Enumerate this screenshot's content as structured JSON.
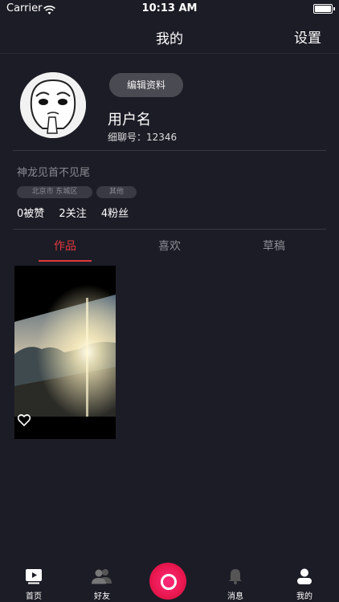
{
  "status_bar": {
    "carrier": "Carrier",
    "time": "10:13 AM"
  },
  "navbar": {
    "title": "我的",
    "settings_label": "设置"
  },
  "profile": {
    "edit_label": "编辑资料",
    "username": "用户名",
    "user_id": "细聊号：12346",
    "bio": "神龙见首不见尾",
    "tags": [
      "北京市 东城区",
      "其他"
    ],
    "stats": {
      "likes": "0被赞",
      "following": "2关注",
      "followers": "4粉丝"
    }
  },
  "tabs": [
    {
      "label": "作品",
      "active": true
    },
    {
      "label": "喜欢",
      "active": false
    },
    {
      "label": "草稿",
      "active": false
    }
  ],
  "works": [
    {
      "thumbnail": "sunset-landscape",
      "liked": false
    }
  ],
  "tab_bar": {
    "items": [
      {
        "label": "首页",
        "icon": "video-icon"
      },
      {
        "label": "好友",
        "icon": "friends-icon"
      },
      {
        "label": "",
        "icon": "record-icon"
      },
      {
        "label": "消息",
        "icon": "bell-icon"
      },
      {
        "label": "我的",
        "icon": "profile-icon"
      }
    ]
  },
  "colors": {
    "background": "#1c1c26",
    "accent": "#e0383e",
    "record_button": "#e8174e"
  }
}
